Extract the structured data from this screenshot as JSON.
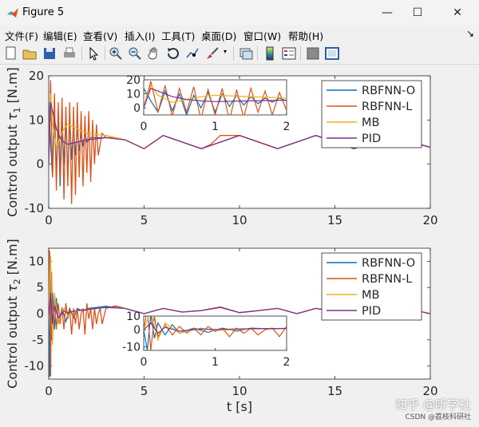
{
  "window": {
    "title": "Figure 5",
    "minimize_glyph": "—",
    "maximize_glyph": "☐",
    "close_glyph": "✕"
  },
  "menu": {
    "items": [
      "文件(F)",
      "编辑(E)",
      "查看(V)",
      "插入(I)",
      "工具(T)",
      "桌面(D)",
      "窗口(W)",
      "帮助(H)"
    ],
    "dock_glyph": "↘"
  },
  "toolbar": {
    "icons": [
      "new-figure-icon",
      "open-icon",
      "save-icon",
      "print-icon",
      "pointer-icon",
      "zoom-in-icon",
      "zoom-out-icon",
      "pan-icon",
      "rotate-icon",
      "data-cursor-icon",
      "brush-icon",
      "link-icon",
      "colorbar-icon",
      "legend-icon",
      "hide-plot-tools-icon",
      "show-plot-tools-icon"
    ]
  },
  "colors": {
    "rbfnn_o": "#0072BD",
    "rbfnn_l": "#D95319",
    "mb": "#EDB120",
    "pid": "#7E2F8E"
  },
  "legend_entries": [
    "RBFNN-O",
    "RBFNN-L",
    "MB",
    "PID"
  ],
  "chart_data": [
    {
      "type": "line",
      "ylabel_text": "Control output ",
      "ylabel_sym": "τ",
      "ylabel_sub": "1",
      "ylabel_unit": " [N.m]",
      "xlabel": "",
      "xlim": [
        0,
        20
      ],
      "ylim": [
        -10,
        20
      ],
      "xticks": [
        "0",
        "5",
        "10",
        "15",
        "20"
      ],
      "yticks": [
        "-10",
        "0",
        "10",
        "20"
      ],
      "legend": "top-right",
      "series": [
        {
          "name": "RBFNN-O",
          "x": [
            0,
            0.1,
            0.2,
            0.3,
            0.4,
            0.5,
            0.6,
            0.7,
            0.8,
            0.9,
            1.0,
            1.1,
            1.2,
            1.3,
            1.4,
            1.5,
            1.6,
            1.7,
            1.8,
            1.9,
            2.0,
            2.2,
            2.4,
            2.6,
            2.8,
            3.0,
            3.5,
            4,
            5,
            6,
            7,
            8,
            9,
            10,
            11,
            12,
            13,
            14,
            15,
            16,
            17,
            18,
            19,
            20
          ],
          "y": [
            14,
            5,
            -3,
            12,
            -2,
            10,
            -5,
            9,
            0,
            11,
            -3,
            10,
            1,
            9,
            2,
            8,
            3,
            7,
            4,
            7,
            5,
            6,
            6,
            6,
            6,
            6,
            6,
            5.5,
            3.5,
            6.5,
            5,
            3.5,
            5,
            6.5,
            5,
            3.5,
            5,
            6.5,
            5,
            3.5,
            5,
            6.5,
            5,
            3.8
          ]
        },
        {
          "name": "RBFNN-L",
          "x": [
            0,
            0.1,
            0.2,
            0.3,
            0.4,
            0.5,
            0.6,
            0.7,
            0.8,
            0.9,
            1.0,
            1.1,
            1.2,
            1.3,
            1.4,
            1.5,
            1.6,
            1.7,
            1.8,
            1.9,
            2.0,
            2.1,
            2.2,
            2.3,
            2.4,
            2.5,
            2.6,
            2.8,
            3.0,
            3.5,
            4,
            5,
            6,
            7,
            8,
            8.5,
            9,
            10,
            11,
            12,
            13,
            14,
            15,
            16,
            17,
            18,
            19,
            20
          ],
          "y": [
            0,
            19,
            -3,
            16,
            -6,
            14,
            -3,
            15,
            -8,
            13,
            -5,
            14,
            -9,
            13,
            -7,
            14,
            -3,
            12,
            -5,
            11,
            -2,
            12,
            -4,
            10,
            0,
            9,
            2,
            7,
            6,
            6,
            5.5,
            3.5,
            6.5,
            5,
            3.5,
            4.5,
            6.5,
            6.5,
            5,
            3.5,
            5,
            6.5,
            5,
            3.5,
            5,
            6.5,
            5,
            3.8
          ]
        },
        {
          "name": "MB",
          "x": [
            0,
            0.1,
            0.2,
            0.4,
            0.6,
            0.8,
            1.0,
            1.5,
            2,
            3,
            4,
            5,
            6,
            7,
            8,
            9,
            10,
            11,
            12,
            13,
            14,
            15,
            16,
            17,
            18,
            19,
            20
          ],
          "y": [
            0,
            16,
            9,
            4,
            6,
            8,
            9,
            8,
            7,
            6.5,
            5.5,
            3.5,
            6.5,
            5,
            3.5,
            5,
            6.5,
            5,
            3.5,
            5,
            6.5,
            5,
            3.5,
            5,
            6.5,
            5,
            3.8
          ]
        },
        {
          "name": "PID",
          "x": [
            0,
            0.1,
            0.2,
            0.4,
            0.6,
            0.8,
            1.0,
            1.5,
            2,
            3,
            4,
            5,
            6,
            7,
            8,
            9,
            10,
            11,
            12,
            13,
            14,
            15,
            16,
            17,
            18,
            19,
            20
          ],
          "y": [
            0,
            14,
            12,
            8,
            6,
            5,
            4.5,
            5,
            5.5,
            6,
            5.5,
            3.5,
            6.5,
            5,
            3.5,
            5,
            6.5,
            5,
            3.5,
            5,
            6.5,
            5,
            3.5,
            5,
            6.5,
            5,
            3.8
          ]
        }
      ],
      "inset": {
        "xlim": [
          0,
          2
        ],
        "ylim": [
          -5,
          20
        ],
        "xticks": [
          "0",
          "1",
          "2"
        ],
        "yticks": [
          "0",
          "10",
          "20"
        ]
      }
    },
    {
      "type": "line",
      "ylabel_text": "Control output ",
      "ylabel_sym": "τ",
      "ylabel_sub": "2",
      "ylabel_unit": " [N.m]",
      "xlabel": "t [s]",
      "xlim": [
        0,
        20
      ],
      "ylim": [
        -12.5,
        12.5
      ],
      "xticks": [
        "0",
        "5",
        "10",
        "15",
        "20"
      ],
      "yticks": [
        "-10",
        "-5",
        "0",
        "5",
        "10"
      ],
      "legend": "top-right",
      "series": [
        {
          "name": "RBFNN-O",
          "x": [
            0,
            0.05,
            0.1,
            0.15,
            0.2,
            0.3,
            0.4,
            0.5,
            0.7,
            0.9,
            1.1,
            1.3,
            1.5,
            1.8,
            2.1,
            2.5,
            3,
            4,
            5,
            6,
            7,
            8,
            9,
            10,
            11,
            12,
            13,
            14,
            15,
            16,
            17,
            18,
            19,
            20
          ],
          "y": [
            0,
            -12,
            9,
            -5,
            4,
            -3,
            3,
            -2,
            1,
            -1.5,
            1,
            -0.8,
            1,
            0.5,
            1,
            1.2,
            1.4,
            1,
            0,
            1,
            0.3,
            0.6,
            1.2,
            0.2,
            0.6,
            1,
            0,
            1,
            0.4,
            0.8,
            1,
            0,
            0.8,
            0
          ]
        },
        {
          "name": "RBFNN-L",
          "x": [
            0,
            0.05,
            0.1,
            0.15,
            0.2,
            0.3,
            0.4,
            0.5,
            0.6,
            0.7,
            0.8,
            0.9,
            1.0,
            1.1,
            1.2,
            1.3,
            1.4,
            1.5,
            1.6,
            1.7,
            1.8,
            1.9,
            2.0,
            2.1,
            2.2,
            2.3,
            2.4,
            2.5,
            2.6,
            2.7,
            2.8,
            3,
            3.5,
            4,
            5,
            6,
            7,
            8,
            9,
            10,
            11,
            12,
            13,
            14,
            15,
            16,
            17,
            18,
            19,
            20
          ],
          "y": [
            0,
            12,
            -12,
            8,
            -4,
            3,
            -3,
            2,
            -2,
            1,
            -3,
            2,
            -1,
            1,
            -4,
            1,
            -2,
            1,
            -3,
            0,
            1,
            -4,
            2,
            -1,
            1,
            -3,
            1,
            -2,
            0,
            1,
            -2,
            1,
            1.5,
            1,
            0,
            1,
            0.3,
            0.6,
            1.3,
            0.2,
            0.6,
            1,
            0,
            1,
            0.4,
            0.8,
            1,
            0,
            0.8,
            0
          ]
        },
        {
          "name": "MB",
          "x": [
            0,
            0.1,
            0.2,
            0.3,
            0.5,
            0.8,
            1,
            1.5,
            2,
            3,
            4,
            5,
            6,
            7,
            8,
            9,
            10,
            11,
            12,
            13,
            14,
            15,
            16,
            17,
            18,
            19,
            20
          ],
          "y": [
            0,
            11,
            -6,
            4,
            -2,
            1,
            -0.5,
            0.5,
            0.8,
            1.2,
            1,
            0,
            1,
            0.3,
            0.6,
            1.2,
            0.2,
            0.6,
            1,
            0,
            1,
            0.4,
            0.8,
            1,
            0,
            0.8,
            0
          ]
        },
        {
          "name": "PID",
          "x": [
            0,
            0.1,
            0.2,
            0.3,
            0.5,
            0.8,
            1,
            1.5,
            2,
            3,
            4,
            5,
            6,
            7,
            8,
            9,
            10,
            11,
            12,
            13,
            14,
            15,
            16,
            17,
            18,
            19,
            20
          ],
          "y": [
            0,
            4,
            -2,
            1.5,
            -0.8,
            0.5,
            0.2,
            0.6,
            0.8,
            1.2,
            1,
            0,
            1,
            0.3,
            0.6,
            1.2,
            0.2,
            0.6,
            1,
            0,
            1,
            0.4,
            0.8,
            1,
            0,
            0.8,
            0
          ]
        }
      ],
      "inset": {
        "xlim": [
          0,
          2
        ],
        "ylim": [
          -12,
          8
        ],
        "xticks": [
          "0",
          "1",
          "2"
        ],
        "yticks": [
          "-10",
          "0",
          "10"
        ]
      }
    }
  ],
  "watermark": {
    "main": "知乎 @听字社",
    "sub": "CSDN @荔枝科研社"
  }
}
